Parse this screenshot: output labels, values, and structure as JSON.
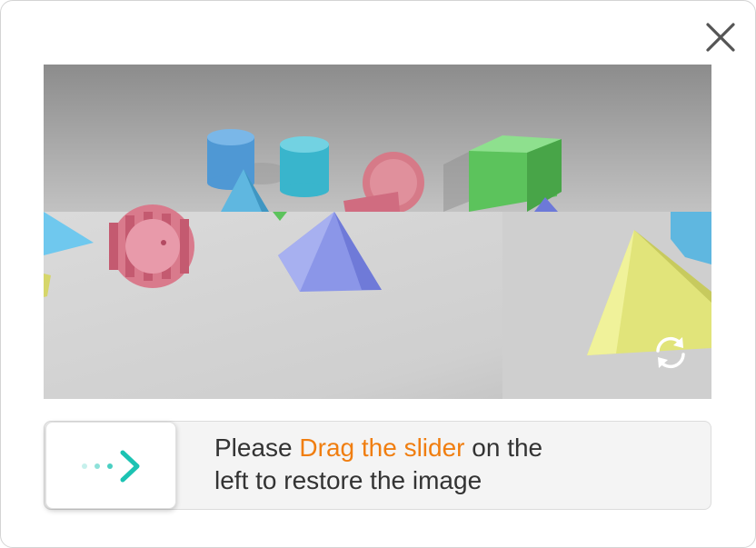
{
  "close_icon": "close-icon",
  "refresh_icon": "refresh-icon",
  "slider": {
    "handle_icon": "dotted-arrow-right-icon",
    "handle_icon_color": "#1cc3b3",
    "offset_fraction": 0
  },
  "hint": {
    "prefix": "Please ",
    "highlight": "Drag the slider",
    "line1_suffix": " on the",
    "line2": "left to restore the image",
    "highlight_color": "#f07e10",
    "text_color": "#333333"
  }
}
